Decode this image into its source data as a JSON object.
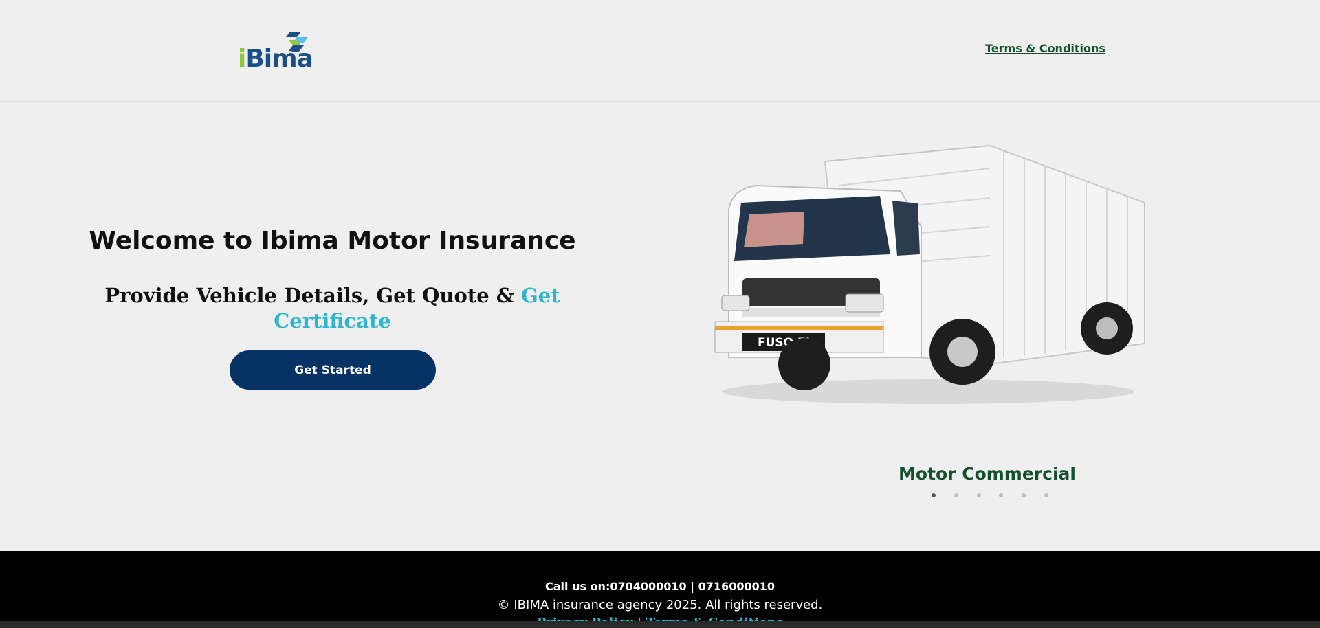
{
  "header": {
    "logo": {
      "text_i": "i",
      "text_rest": "Bima",
      "colors": {
        "green": "#8dc63f",
        "blue": "#1a4f8a",
        "light_blue": "#5bc0e8"
      }
    },
    "terms_link": "Terms & Conditions"
  },
  "hero": {
    "title": "Welcome to Ibima Motor Insurance",
    "subtitle_plain": "Provide Vehicle Details, Get Quote & ",
    "subtitle_accent": "Get Certificate",
    "cta_label": "Get Started",
    "colors": {
      "accent": "#2fb5cf",
      "button": "#073364"
    }
  },
  "carousel": {
    "caption": "Motor Commercial",
    "truck_plate": "FUSO FI",
    "active_index": 0,
    "dot_count": 6
  },
  "footer": {
    "call_text": "Call us on:0704000010 | 0716000010",
    "copyright": "© IBIMA insurance agency 2025. All rights reserved.",
    "privacy_label": "Privacy Policy",
    "separator": " | ",
    "terms_label": "Terms & Conditions"
  }
}
